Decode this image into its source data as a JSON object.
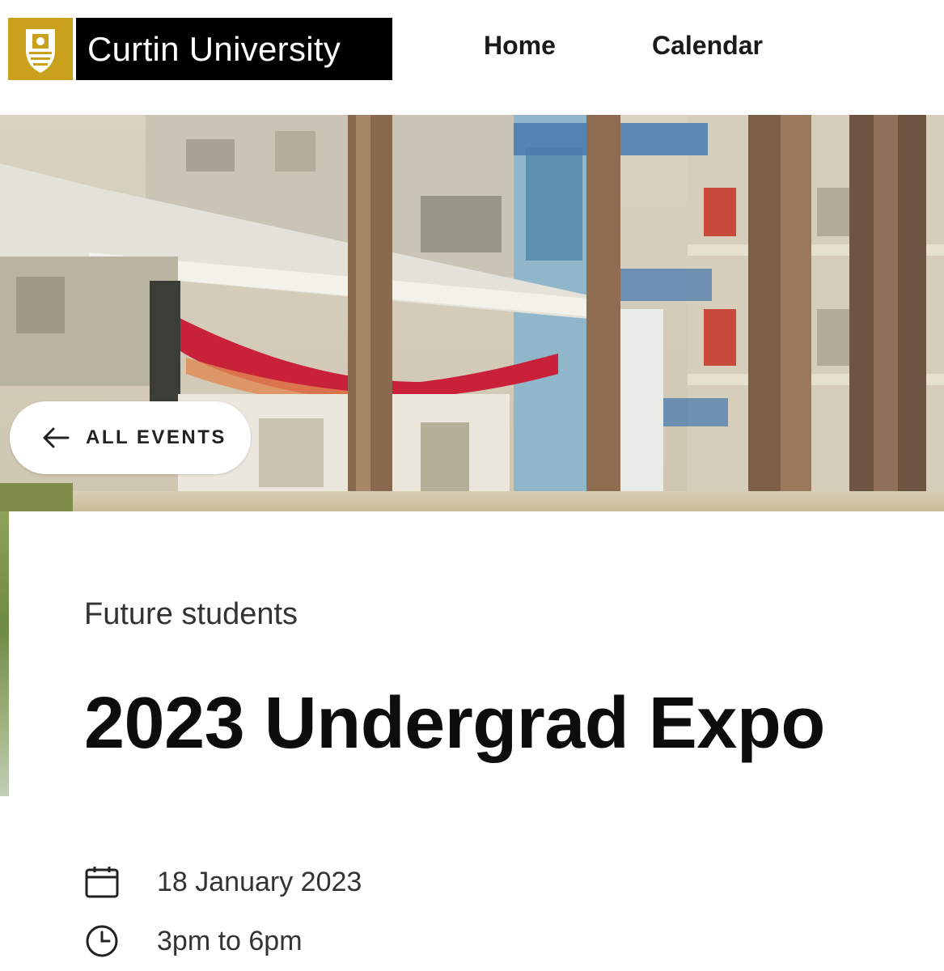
{
  "header": {
    "brand": "Curtin University",
    "nav": [
      {
        "label": "Home"
      },
      {
        "label": "Calendar"
      }
    ]
  },
  "hero": {
    "back_label": "ALL EVENTS"
  },
  "event": {
    "category": "Future students",
    "title": "2023 Undergrad Expo",
    "date": "18 January 2023",
    "time": "3pm to 6pm"
  },
  "colors": {
    "brand_gold": "#c9a11c",
    "brand_black": "#000000"
  },
  "icons": {
    "logo": "curtin-shield-icon",
    "back": "arrow-left-icon",
    "date": "calendar-icon",
    "time": "clock-icon"
  }
}
